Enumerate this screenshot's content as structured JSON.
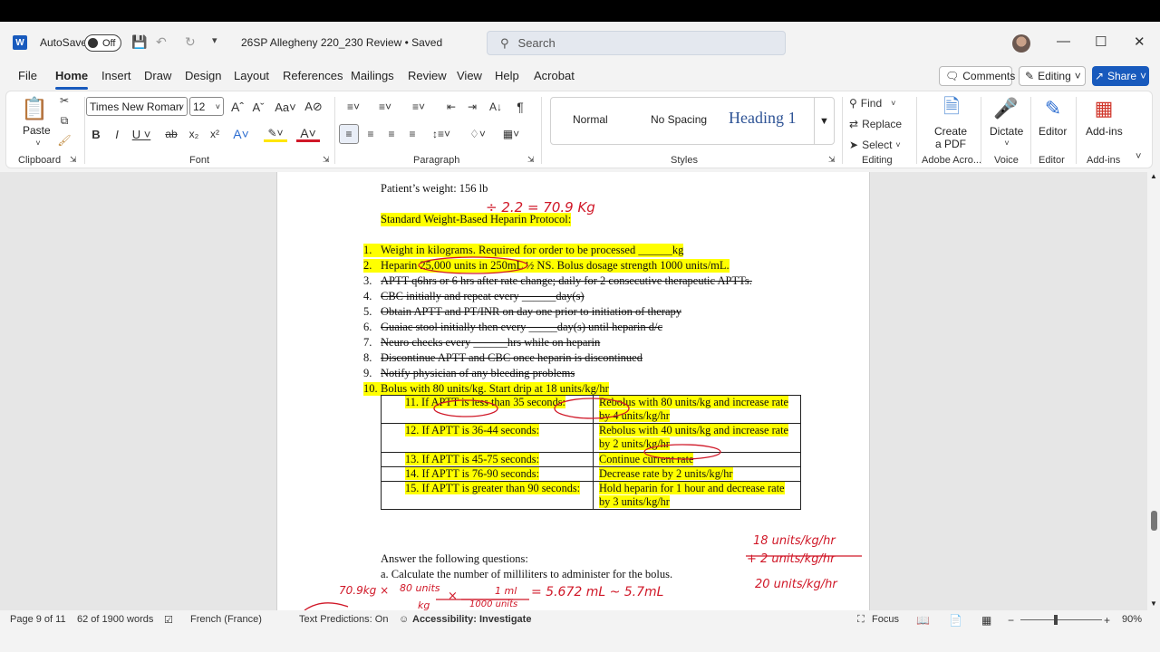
{
  "titlebar": {
    "logo": "W",
    "autosave_label": "AutoSave",
    "autosave_state": "Off",
    "doc_title": "26SP Allegheny 220_230 Review • Saved",
    "search_placeholder": "Search"
  },
  "tabs": [
    "File",
    "Home",
    "Insert",
    "Draw",
    "Design",
    "Layout",
    "References",
    "Mailings",
    "Review",
    "View",
    "Help",
    "Acrobat"
  ],
  "tab_actions": {
    "comments": "Comments",
    "editing": "Editing",
    "share": "Share"
  },
  "ribbon": {
    "clipboard": {
      "paste": "Paste",
      "label": "Clipboard"
    },
    "font": {
      "name": "Times New Roman",
      "size": "12",
      "label": "Font"
    },
    "paragraph": {
      "label": "Paragraph"
    },
    "styles": {
      "normal": "Normal",
      "no_spacing": "No Spacing",
      "heading1": "Heading 1",
      "label": "Styles"
    },
    "editing": {
      "find": "Find",
      "replace": "Replace",
      "select": "Select",
      "label": "Editing"
    },
    "acrobat": {
      "create_pdf": "Create\na PDF",
      "label": "Adobe Acro..."
    },
    "voice": {
      "dictate": "Dictate",
      "label": "Voice"
    },
    "editor": {
      "editor": "Editor",
      "label": "Editor"
    },
    "addins": {
      "addins": "Add-ins",
      "label": "Add-ins"
    }
  },
  "document": {
    "weight_line": "Patient’s weight: 156 lb",
    "protocol_title": "Standard Weight-Based Heparin Protocol:",
    "items": [
      {
        "n": "1.",
        "text": "Weight in kilograms.  Required for order to be processed ______kg"
      },
      {
        "n": "2.",
        "text": "Heparin 25,000 units in 250mL ½ NS.  Bolus dosage strength 1000 units/mL."
      },
      {
        "n": "3.",
        "text": "APTT q6hrs or 6 hrs after rate change; daily for 2 consecutive therapeutic APTTs."
      },
      {
        "n": "4.",
        "text": "CBC initially and repeat every ______day(s)"
      },
      {
        "n": "5.",
        "text": "Obtain APTT and PT/INR on day one prior to initiation of therapy"
      },
      {
        "n": "6.",
        "text": "Guaiac stool initially then every _____day(s) until heparin d/c"
      },
      {
        "n": "7.",
        "text": "Neuro checks every ______hrs while on heparin"
      },
      {
        "n": "8.",
        "text": "Discontinue APTT and CBC once heparin is discontinued"
      },
      {
        "n": "9.",
        "text": "Notify physician of any bleeding problems"
      },
      {
        "n": "10.",
        "text": "Bolus with 80 units/kg.  Start drip at 18 units/kg/hr"
      }
    ],
    "table": [
      [
        "11. If APTT is less than 35 seconds:",
        "Rebolus with 80 units/kg and increase rate by 4 units/kg/hr"
      ],
      [
        "12. If APTT is 36-44 seconds:",
        "Rebolus with 40 units/kg and increase rate by 2 units/kg/hr"
      ],
      [
        "13. If APTT is 45-75 seconds:",
        "Continue current rate"
      ],
      [
        "14. If APTT is 76-90 seconds:",
        "Decrease rate by 2 units/kg/hr"
      ],
      [
        "15. If APTT is greater than 90 seconds:",
        "Hold heparin for 1 hour and decrease rate by 3 units/kg/hr"
      ]
    ],
    "questions_title": "Answer the following questions:",
    "question_a": "a.   Calculate the number of milliliters to administer for the bolus."
  },
  "handwriting": {
    "weight_calc": "÷ 2.2 = 70.9 Kg",
    "rate1": "18 units/kg/hr",
    "rate2": "+ 2 units/kg/hr",
    "rate3": "20 units/kg/hr",
    "bolus_a": "70.9kg ×",
    "bolus_b": "80 units",
    "bolus_c": "kg",
    "bolus_d": "×",
    "bolus_e": "1 ml",
    "bolus_f": "1000 units",
    "bolus_g": "= 5.672 mL ~ 5.7mL"
  },
  "statusbar": {
    "page": "Page 9 of 11",
    "words": "62 of 1900 words",
    "language": "French (France)",
    "predictions": "Text Predictions: On",
    "accessibility": "Accessibility: Investigate",
    "focus": "Focus",
    "zoom": "90%"
  },
  "colors": {
    "accent": "#185abd",
    "highlight": "#ffff00",
    "ink": "#d01828"
  }
}
